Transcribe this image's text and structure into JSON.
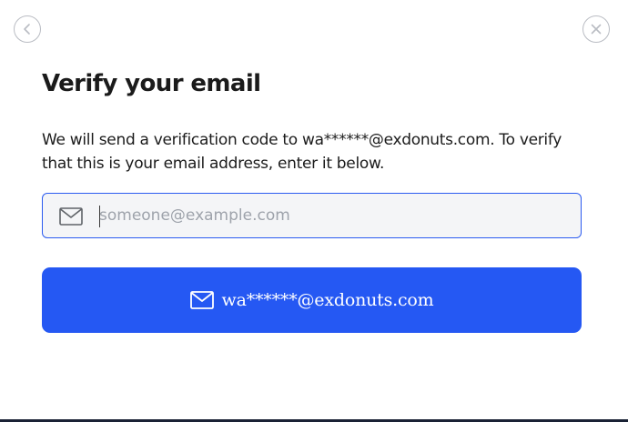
{
  "dialog": {
    "title": "Verify your email",
    "description": "We will send a verification code to wa******@exdonuts.com. To verify that this is your email address, enter it below.",
    "email_field": {
      "value": "",
      "placeholder": "someone@example.com",
      "icon": "mail-icon"
    },
    "send_button": {
      "label": "wa******@exdonuts.com",
      "icon": "mail-icon"
    },
    "back_button": {
      "icon": "chevron-left-icon"
    },
    "close_button": {
      "icon": "close-icon"
    }
  },
  "colors": {
    "accent": "#2558f3",
    "field_border": "#2b5bf0",
    "field_background": "#f4f5f7",
    "text": "#1b1b1b",
    "placeholder": "#9ea3ab",
    "nav_icon": "#b9bcc3"
  }
}
